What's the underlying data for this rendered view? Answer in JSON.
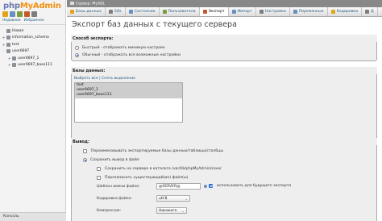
{
  "nav": {
    "logo_php": "php",
    "logo_my": "My",
    "logo_admin": "Admin",
    "icon_colors": [
      "#e2a41b",
      "#6b8fbf",
      "#7c9c3e",
      "#c25a2c",
      "#7d7d7d"
    ],
    "tabs": [
      "Недавние",
      "Избранное"
    ],
    "tree": [
      {
        "toggle": "",
        "label": "Новая"
      },
      {
        "toggle": "+",
        "label": "information_schema"
      },
      {
        "toggle": "+",
        "label": "test"
      },
      {
        "toggle": "-",
        "label": "user6697"
      },
      {
        "toggle": "+",
        "label": "user6697_1",
        "sub": true
      },
      {
        "toggle": "+",
        "label": "user6697_base111",
        "sub": true
      }
    ],
    "console_label": "Консоль"
  },
  "crumb": {
    "text": "Сервер: MySQL"
  },
  "tabs": [
    {
      "label": "Базы данных",
      "icon": "#e2a41b",
      "active": false
    },
    {
      "label": "SQL",
      "icon": "#7d7d7d",
      "active": false
    },
    {
      "label": "Состояние",
      "icon": "#6b8fbf",
      "active": false
    },
    {
      "label": "Пользователи",
      "icon": "#7c9c3e",
      "active": false
    },
    {
      "label": "Экспорт",
      "icon": "#c25a2c",
      "active": true
    },
    {
      "label": "Импорт",
      "icon": "#6b8fbf",
      "active": false
    },
    {
      "label": "Настройки",
      "icon": "#7d7d7d",
      "active": false
    },
    {
      "label": "Переменные",
      "icon": "#6b8fbf",
      "active": false
    },
    {
      "label": "Кодировки",
      "icon": "#e2a41b",
      "active": false
    },
    {
      "label": "Д",
      "icon": "#7d7d7d",
      "active": false
    }
  ],
  "main": {
    "title": "Экспорт баз данных с текущего сервера",
    "method": {
      "legend": "Способ экспорта:",
      "options": [
        {
          "label": "Быстрый - отображать минимум настроек",
          "checked": false
        },
        {
          "label": "Обычный - отображать все возможные настройки",
          "checked": true
        }
      ]
    },
    "databases": {
      "legend": "Базы данных:",
      "select_all": "Выбрать все",
      "deselect_all": "Снять выделение",
      "items": [
        "test",
        "user6697_1",
        "user6697_base111"
      ]
    },
    "output": {
      "legend": "Вывод:",
      "rename_label": "Переименовывать экспортируемые базы данных/таблицы/столбцы",
      "save_label": "Сохранить вывод в файл",
      "save_on_server_label": "Сохранить на сервере в каталоге /var/lib/phpMyAdmin/save/",
      "overwrite_label": "Перезаписать существующий(ие) файл(ы)",
      "filename_label": "Шаблон имени файла:",
      "filename_value": "@SERVER@",
      "use_later_label": "использовать для будущего экспорта",
      "charset_label": "Кодировка файла:",
      "charset_value": "utf-8",
      "compression_label": "Компрессия:",
      "compression_value": "Никакого"
    }
  }
}
